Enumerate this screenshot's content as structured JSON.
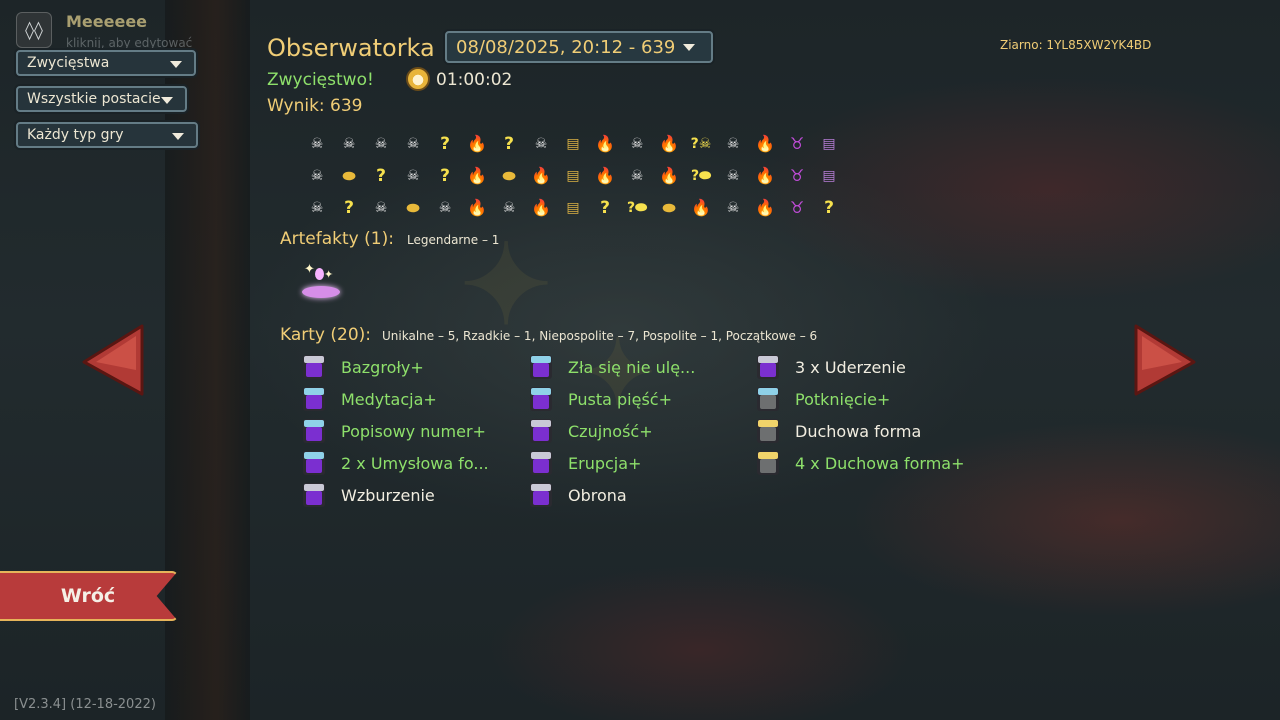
{
  "profile": {
    "name": "Meeeeee",
    "hint": "kliknij, aby edytować"
  },
  "filters": {
    "result": "Zwycięstwa",
    "character": "Wszystkie postacie",
    "game_type": "Każdy typ gry"
  },
  "header": {
    "character_name": "Obserwatorka",
    "run_select": "08/08/2025, 20:12 - 639",
    "result": "Zwycięstwo!",
    "time": "01:00:02",
    "score": "Wynik: 639",
    "seed": "Ziarno: 1YL85XW2YK4BD"
  },
  "path": {
    "rows": [
      [
        "monster",
        "monster",
        "monster",
        "monster",
        "unknown",
        "rest",
        "unknown",
        "monster",
        "chest",
        "rest",
        "monster",
        "rest",
        "unknown-monster",
        "monster",
        "rest",
        "boss",
        "boss-chest"
      ],
      [
        "monster",
        "shop",
        "unknown",
        "monster",
        "unknown",
        "rest",
        "shop",
        "rest",
        "chest",
        "rest",
        "monster",
        "rest",
        "unknown-shop",
        "monster",
        "rest",
        "boss",
        "boss-chest"
      ],
      [
        "monster",
        "unknown",
        "monster",
        "shop",
        "monster",
        "rest",
        "monster",
        "rest",
        "chest",
        "unknown",
        "unknown-shop",
        "shop",
        "rest",
        "monster",
        "rest",
        "boss",
        "unknown"
      ]
    ]
  },
  "relics": {
    "heading": "Artefakty (1):",
    "summary": "Legendarne – 1",
    "items": [
      {
        "icon": "liquid-memories-icon"
      }
    ]
  },
  "cards": {
    "heading": "Karty (20):",
    "summary": "Unikalne – 5, Rzadkie – 1, Niepospolite – 7, Pospolite – 1, Początkowe – 6",
    "columns": [
      [
        {
          "label": "Bazgroły+",
          "upgraded": true,
          "color": "purple",
          "rarity": "common"
        },
        {
          "label": "Medytacja+",
          "upgraded": true,
          "color": "purple",
          "rarity": "uncommon"
        },
        {
          "label": "Popisowy numer+",
          "upgraded": true,
          "color": "purple",
          "rarity": "uncommon"
        },
        {
          "label": "2 x Umysłowa fo...",
          "upgraded": true,
          "color": "purple",
          "rarity": "uncommon"
        },
        {
          "label": "Wzburzenie",
          "upgraded": false,
          "color": "purple",
          "rarity": "starter"
        }
      ],
      [
        {
          "label": "Zła się nie ulę...",
          "upgraded": true,
          "color": "purple",
          "rarity": "uncommon"
        },
        {
          "label": "Pusta pięść+",
          "upgraded": true,
          "color": "purple",
          "rarity": "uncommon"
        },
        {
          "label": "Czujność+",
          "upgraded": true,
          "color": "purple",
          "rarity": "starter"
        },
        {
          "label": "Erupcja+",
          "upgraded": true,
          "color": "purple",
          "rarity": "starter"
        },
        {
          "label": "Obrona",
          "upgraded": false,
          "color": "purple",
          "rarity": "starter"
        }
      ],
      [
        {
          "label": "3 x Uderzenie",
          "upgraded": false,
          "color": "purple",
          "rarity": "starter"
        },
        {
          "label": "Potknięcie+",
          "upgraded": true,
          "color": "colorless",
          "rarity": "uncommon"
        },
        {
          "label": "Duchowa forma",
          "upgraded": false,
          "color": "colorless",
          "rarity": "rare"
        },
        {
          "label": "4 x Duchowa forma+",
          "upgraded": true,
          "color": "colorless",
          "rarity": "rare"
        }
      ]
    ]
  },
  "nav": {
    "prev_icon": "arrow-left-icon",
    "next_icon": "arrow-right-icon"
  },
  "back_button": "Wróć",
  "version": "[V2.3.4] (12-18-2022)",
  "colors": {
    "gold": "#f0cd76",
    "green": "#8ee06b",
    "red_button": "#b83b3b"
  }
}
